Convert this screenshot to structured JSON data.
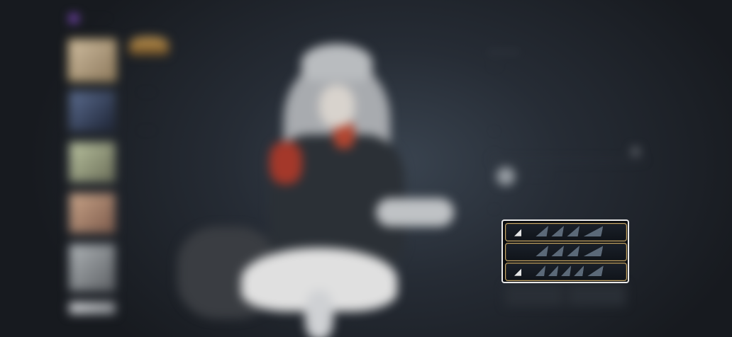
{
  "left": {
    "brand_text": "· · · · ·",
    "thumbnails": [
      "t1",
      "t2",
      "t3",
      "t4",
      "t5",
      "t6"
    ],
    "category_labels": [
      "· · · ·",
      "· · · ·"
    ]
  },
  "info": {
    "name": "· · · ·",
    "subtitle": "· · ·"
  },
  "sections": {
    "label1": "· ·",
    "label2": "· ·",
    "weapon_label": "· · · · ·",
    "label3": "· ·"
  },
  "cards": [
    {
      "icon": "wizard-hat-icon",
      "glyph": "◢",
      "marks": 4
    },
    {
      "icon": "",
      "glyph": "",
      "marks": 4
    },
    {
      "icon": "wizard-hat-icon",
      "glyph": "◢",
      "marks": 5
    }
  ],
  "colors": {
    "accent_gold": "#c7a86a",
    "panel_border": "#e9e9e9",
    "thumb_selected": "#d1b06b"
  }
}
